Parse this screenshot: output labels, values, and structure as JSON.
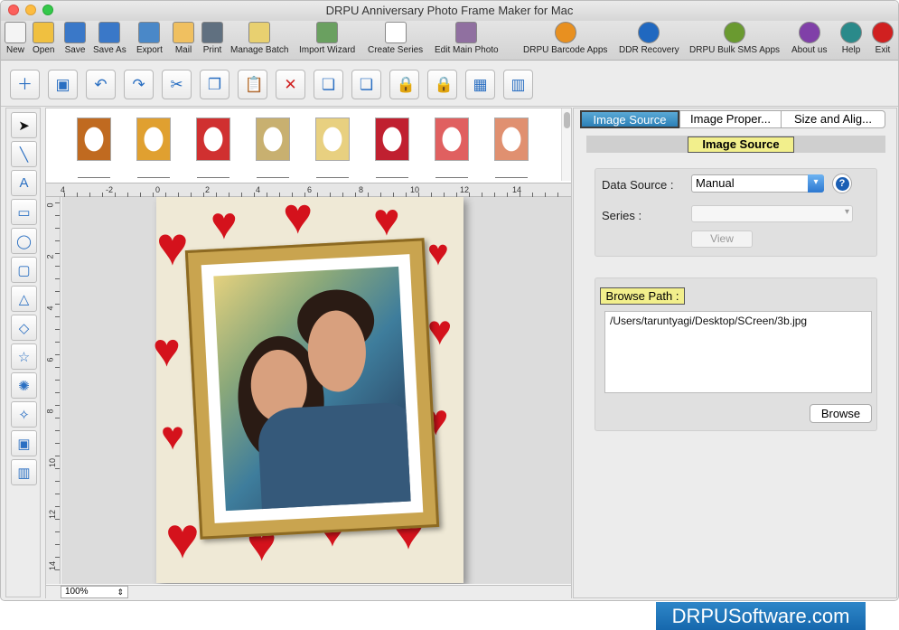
{
  "window": {
    "title": "DRPU Anniversary Photo Frame Maker for Mac"
  },
  "toolbar": [
    {
      "label": "New",
      "icon": "new-document-icon",
      "color": "#f4f4f4"
    },
    {
      "label": "Open",
      "icon": "open-folder-icon",
      "color": "#f0c040"
    },
    {
      "label": "Save",
      "icon": "save-disk-icon",
      "color": "#3a78c8"
    },
    {
      "label": "Save As",
      "icon": "save-as-disk-icon",
      "color": "#3a78c8"
    },
    {
      "label": "Export",
      "icon": "export-icon",
      "color": "#4a88c8"
    },
    {
      "label": "Mail",
      "icon": "mail-icon",
      "color": "#f0c060"
    },
    {
      "label": "Print",
      "icon": "print-icon",
      "color": "#607080"
    },
    {
      "label": "Manage Batch",
      "icon": "manage-batch-icon",
      "color": "#e8d070"
    },
    {
      "label": "Import Wizard",
      "icon": "import-wizard-icon",
      "color": "#6aa060"
    },
    {
      "label": "Create Series",
      "icon": "create-series-icon",
      "color": "#ffffff"
    },
    {
      "label": "Edit Main Photo",
      "icon": "edit-photo-icon",
      "color": "#9070a0"
    },
    {
      "label": "DRPU Barcode Apps",
      "icon": "barcode-apps-icon",
      "color": "#e89020"
    },
    {
      "label": "DDR Recovery",
      "icon": "ddr-recovery-icon",
      "color": "#2068c0"
    },
    {
      "label": "DRPU Bulk SMS Apps",
      "icon": "bulk-sms-icon",
      "color": "#6a9a30"
    },
    {
      "label": "About us",
      "icon": "about-us-icon",
      "color": "#8040a8"
    },
    {
      "label": "Help",
      "icon": "help-icon",
      "color": "#2a8a8a"
    },
    {
      "label": "Exit",
      "icon": "exit-icon",
      "color": "#d02020"
    }
  ],
  "edit_toolbar": [
    "add-page-icon",
    "frame-icon",
    "undo-icon",
    "redo-icon",
    "cut-icon",
    "copy-icon",
    "paste-icon",
    "delete-icon",
    "bring-front-icon",
    "send-back-icon",
    "lock-icon",
    "unlock-icon",
    "grid-icon",
    "ruler-icon"
  ],
  "drawing_tools": [
    "pointer-icon",
    "line-icon",
    "text-icon",
    "rectangle-icon",
    "ellipse-icon",
    "rounded-rect-icon",
    "triangle-icon",
    "diamond-icon",
    "star-icon",
    "burst-icon",
    "cross-star-icon",
    "image-icon",
    "library-icon"
  ],
  "canvas": {
    "thumbnail_colors": [
      "#c06a20",
      "#e0a030",
      "#d03030",
      "#c8b070",
      "#e8d080",
      "#c02030",
      "#e06060",
      "#e09070"
    ],
    "hruler_labels": [
      "4",
      "-2",
      "0",
      "2",
      "4",
      "6",
      "8",
      "10",
      "12",
      "14"
    ],
    "vruler_labels": [
      "0",
      "2",
      "4",
      "6",
      "8",
      "10",
      "12",
      "14"
    ],
    "zoom": "100%"
  },
  "panel": {
    "tabs": [
      "Image Source",
      "Image Proper...",
      "Size and Alig..."
    ],
    "section_title": "Image Source",
    "data_source_label": "Data Source :",
    "data_source_value": "Manual",
    "help_label": "?",
    "series_label": "Series :",
    "view_label": "View",
    "browse_path_label": "Browse Path :",
    "browse_path_value": "/Users/taruntyagi/Desktop/SCreen/3b.jpg",
    "browse_label": "Browse"
  },
  "brand": "DRPUSoftware.com"
}
